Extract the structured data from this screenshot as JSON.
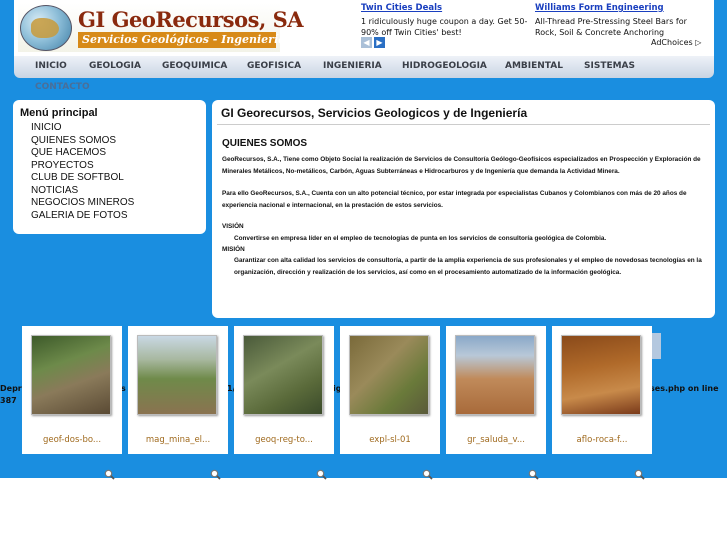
{
  "logo": {
    "title": "GI GeoRecursos, SA",
    "subtitle": "Servicios Geológicos - Ingeniería"
  },
  "ads": [
    {
      "title": "Twin Cities Deals",
      "body": "1 ridiculously huge coupon a day. Get 50-90% off Twin Cities' best!"
    },
    {
      "title": "Williams Form Engineering",
      "body": "All-Thread Pre-Stressing Steel Bars for Rock, Soil & Concrete Anchoring"
    }
  ],
  "ad_prev": "◀",
  "ad_next": "▶",
  "ad_choices": "AdChoices ▷",
  "nav": [
    "INICIO",
    "GEOLOGIA",
    "GEOQUIMICA",
    "GEOFISICA",
    "INGENIERIA",
    "HIDROGEOLOGIA",
    "AMBIENTAL",
    "SISTEMAS"
  ],
  "nav_extra": "CONTACTO",
  "menu": {
    "title": "Menú principal",
    "items": [
      "INICIO",
      "QUIENES SOMOS",
      "QUE HACEMOS",
      "PROYECTOS",
      "CLUB DE SOFTBOL",
      "NOTICIAS",
      "NEGOCIOS MINEROS",
      "GALERIA DE FOTOS"
    ]
  },
  "content": {
    "title": "GI Georecursos, Servicios Geologicos y de Ingeniería",
    "heading": "QUIENES SOMOS",
    "p1": "GeoRecursos, S.A., Tiene como Objeto Social la realización de Servicios de Consultoría Geólogo-Geofísicos especializados en Prospección y Exploración de Minerales Metálicos, No-metálicos, Carbón, Aguas Subterráneas e Hidrocarburos y de Ingeniería que demanda la Actividad Minera.",
    "p2": "Para ello GeoRecursos, S.A., Cuenta con un alto potencial técnico, por estar integrada por especialistas Cubanos y Colombianos con más de 20 años de experiencia nacional e internacional, en la prestación de estos servicios.",
    "vision_label": "VISIÓN",
    "vision": "Convertirse en empresa líder en el empleo de tecnologías de punta en los servicios de consultoría geológica de Colombia.",
    "mision_label": "MISIÓN",
    "mision": "Garantizar con alta calidad los servicios de consultoría, a partir de la amplia experiencia de sus profesionales y el empleo de novedosas tecnologías en la organización, dirección y realización de los servicios, así como en el procesamiento automatizado de la información geológica."
  },
  "error": {
    "prefix": "Depr",
    "c1": "s",
    "c2": "1/",
    "c3": "ig",
    "suffix": "ses.php on line",
    "line": "387"
  },
  "gallery": [
    "geof-dos-bo...",
    "mag_mina_el...",
    "geoq-reg-to...",
    "expl-sl-01",
    "gr_saluda_v...",
    "aflo-roca-f..."
  ]
}
